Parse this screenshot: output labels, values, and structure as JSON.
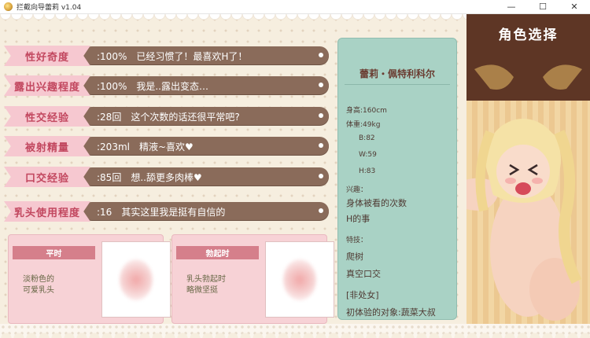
{
  "window": {
    "title": "拦截向导蕾莉 v1.04",
    "controls": {
      "minimize": "—",
      "maximize": "☐",
      "close": "✕"
    }
  },
  "stats": [
    {
      "label": "性好奇度",
      "value": ":100%　已经习惯了！最喜欢H了！"
    },
    {
      "label": "露出兴趣程度",
      "value": ":100%　我是..露出变态…"
    },
    {
      "label": "性交经验",
      "value": ":28回　这个次数的话还很平常吧?"
    },
    {
      "label": "被射精量",
      "value": ":203ml　精液~喜欢♥"
    },
    {
      "label": "口交经验",
      "value": ":85回　想..舔更多肉棒♥"
    },
    {
      "label": "乳头使用程度",
      "value": ":16　其实这里我是挺有自信的"
    }
  ],
  "cards": [
    {
      "title": "平时",
      "text": "淡粉色的\n可爱乳头"
    },
    {
      "title": "勃起时",
      "text": "乳头勃起时\n略微坚挺"
    }
  ],
  "profile": {
    "name": "蕾莉・佩特利科尔",
    "height": "身高:160cm",
    "weight": "体重:49kg",
    "bust": "B:82",
    "waist": "W:59",
    "hip": "H:83",
    "hobby_label": "兴趣：",
    "hobby_1": "身体被看的次数",
    "hobby_2": "H的事",
    "skill_label": "特技：",
    "skill_1": "爬树",
    "skill_2": "真空口交",
    "status": "[非处女]",
    "first_partner": "初体验的对象:蔬菜大叔"
  },
  "character_select": {
    "title": "角色选择"
  },
  "colors": {
    "label_pink": "#f6c8d0",
    "label_text": "#c2475f",
    "bar_brown": "#8a6b5a",
    "profile_mint": "#a9d2c5",
    "header_brown": "#5e3625"
  }
}
